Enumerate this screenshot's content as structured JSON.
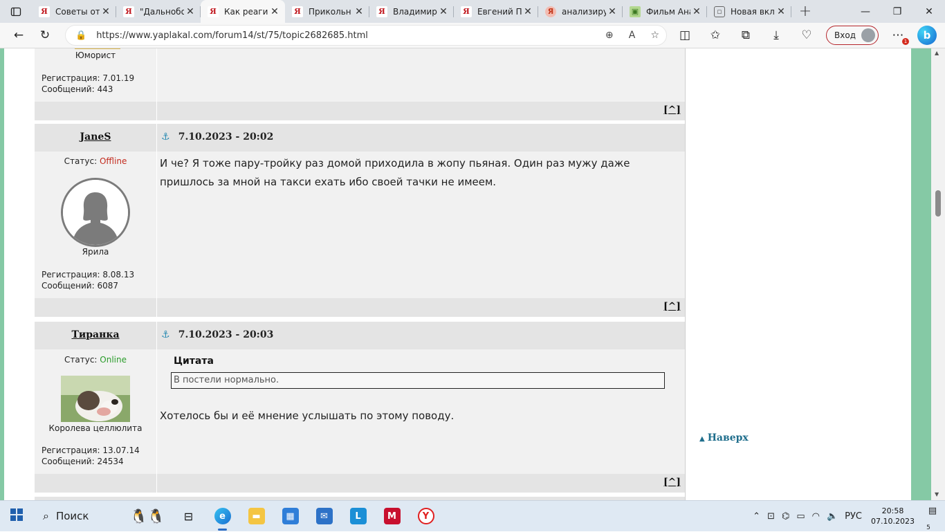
{
  "browser": {
    "tabs": [
      {
        "title": "Советы от",
        "favicon": "yap-icon",
        "active": false
      },
      {
        "title": "\"Дальнобо",
        "favicon": "yap-icon",
        "active": false
      },
      {
        "title": "Как реагир",
        "favicon": "yap-icon",
        "active": true
      },
      {
        "title": "Прикольн",
        "favicon": "yap-icon",
        "active": false
      },
      {
        "title": "Владимир",
        "favicon": "yap-icon",
        "active": false
      },
      {
        "title": "Евгений П",
        "favicon": "yap-icon",
        "active": false
      },
      {
        "title": "анализиру",
        "favicon": "yandex-icon",
        "active": false
      },
      {
        "title": "Фильм Ана",
        "favicon": "film-icon",
        "active": false
      },
      {
        "title": "Новая вкл",
        "favicon": "newtab-icon",
        "active": false
      }
    ],
    "url": "https://www.yaplakal.com/forum14/st/75/topic2682685.html",
    "login_label": "Вход",
    "notification_badge": "1"
  },
  "prev_post": {
    "rank": "Юморист",
    "reg": "Регистрация: 7.01.19",
    "msgs": "Сообщений: 443"
  },
  "posts": [
    {
      "username": "JaneS",
      "datetime": "7.10.2023 - 20:02",
      "status_label": "Статус: ",
      "status": "Offline",
      "rank": "Ярила",
      "reg": "Регистрация: 8.08.13",
      "msgs": "Сообщений: 6087",
      "text_line1": "И че? Я тоже пару-тройку раз домой приходила в жопу пьяная. Один раз мужу даже",
      "text_line2": "пришлось за мной на такси ехать ибо своей тачки не имеем."
    },
    {
      "username": "Тиранка",
      "datetime": "7.10.2023 - 20:03",
      "status_label": "Статус: ",
      "status": "Online",
      "rank": "Королева целлюлита",
      "reg": "Регистрация: 13.07.14",
      "msgs": "Сообщений: 24534",
      "quote_label": "Цитата",
      "quote_text": "В постели нормально.",
      "text_line1": "Хотелось бы и её мнение услышать по этому поводу."
    }
  ],
  "top_link": "[^]",
  "sidebar": {
    "back_to_top": "Наверх"
  },
  "taskbar": {
    "search_label": "Поиск",
    "language": "РУС",
    "time": "20:58",
    "date": "07.10.2023",
    "notif_count": "5"
  },
  "colors": {
    "page_side": "#85c9a5",
    "offline": "#c32b1e",
    "online": "#2a9c2a",
    "link_top": "#1f6e8c"
  }
}
